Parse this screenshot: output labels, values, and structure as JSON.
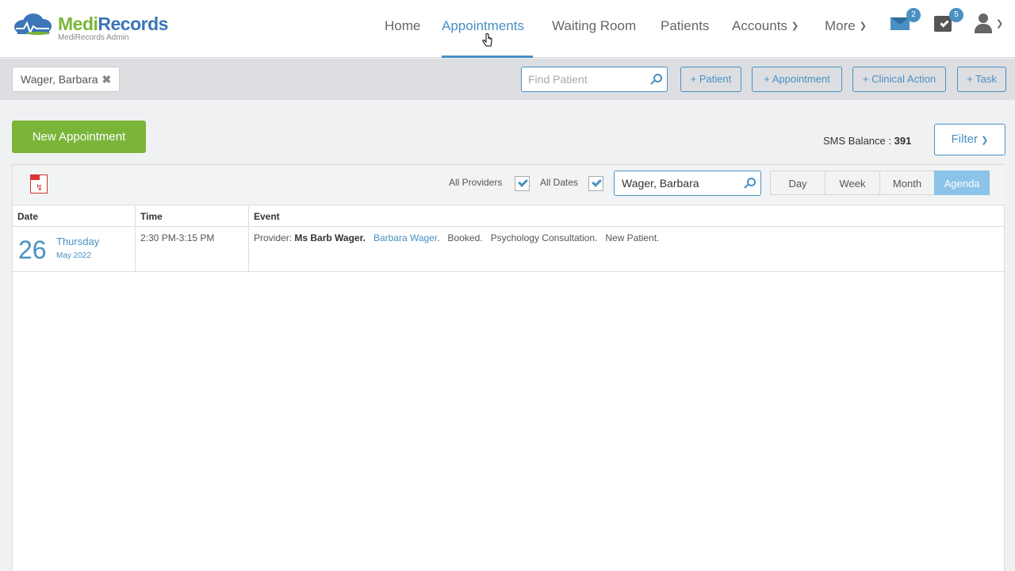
{
  "brand": {
    "name_part1": "Medi",
    "name_part2": "Records",
    "subtitle": "MediRecords Admin",
    "colors": {
      "green": "#7ab53a",
      "blue": "#3a76b8",
      "accent": "#4a90c2"
    }
  },
  "nav": {
    "home": "Home",
    "appointments": "Appointments",
    "waiting_room": "Waiting Room",
    "patients": "Patients",
    "accounts": "Accounts",
    "more": "More",
    "mail_count": "2",
    "tasks_count": "5"
  },
  "subbar": {
    "patient_tag": "Wager, Barbara",
    "find_placeholder": "Find Patient",
    "btn_patient": "+ Patient",
    "btn_appointment": "+ Appointment",
    "btn_clinical_action": "+ Clinical Action",
    "btn_task": "+ Task"
  },
  "actions": {
    "new_appointment": "New Appointment",
    "sms_label": "SMS Balance : ",
    "sms_value": "391",
    "filter": "Filter"
  },
  "calendar": {
    "all_providers": "All Providers",
    "all_dates": "All Dates",
    "search_value": "Wager, Barbara",
    "views": {
      "day": "Day",
      "week": "Week",
      "month": "Month",
      "agenda": "Agenda"
    },
    "selected_view": "Agenda",
    "columns": {
      "date": "Date",
      "time": "Time",
      "event": "Event"
    },
    "rows": [
      {
        "day": "26",
        "weekday": "Thursday",
        "month_year": "May 2022",
        "time": "2:30 PM-3:15 PM",
        "event_prefix": "Provider: ",
        "provider": "Ms Barb Wager.",
        "patient": "Barbara Wager",
        "status": "Booked.",
        "type": "Psychology Consultation.",
        "note": "New Patient."
      }
    ]
  }
}
